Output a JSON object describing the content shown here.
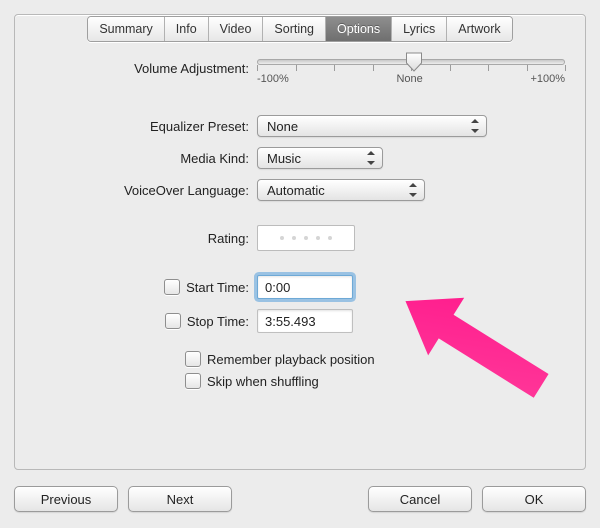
{
  "tabs": [
    {
      "label": "Summary",
      "selected": false
    },
    {
      "label": "Info",
      "selected": false
    },
    {
      "label": "Video",
      "selected": false
    },
    {
      "label": "Sorting",
      "selected": false
    },
    {
      "label": "Options",
      "selected": true
    },
    {
      "label": "Lyrics",
      "selected": false
    },
    {
      "label": "Artwork",
      "selected": false
    }
  ],
  "volume": {
    "label": "Volume Adjustment:",
    "min_label": "-100%",
    "mid_label": "None",
    "max_label": "+100%",
    "value_percent": 50
  },
  "equalizer": {
    "label": "Equalizer Preset:",
    "value": "None"
  },
  "media_kind": {
    "label": "Media Kind:",
    "value": "Music"
  },
  "voiceover": {
    "label": "VoiceOver Language:",
    "value": "Automatic"
  },
  "rating": {
    "label": "Rating:",
    "value": 0,
    "max": 5
  },
  "start_time": {
    "label": "Start Time:",
    "value": "0:00",
    "checked": false,
    "focused": true
  },
  "stop_time": {
    "label": "Stop Time:",
    "value": "3:55.493",
    "checked": false
  },
  "remember": {
    "label": "Remember playback position",
    "checked": false
  },
  "skip": {
    "label": "Skip when shuffling",
    "checked": false
  },
  "buttons": {
    "previous": "Previous",
    "next": "Next",
    "cancel": "Cancel",
    "ok": "OK"
  },
  "annotation": {
    "kind": "arrow",
    "color": "#ff1a8c",
    "target": "start-time-field"
  }
}
